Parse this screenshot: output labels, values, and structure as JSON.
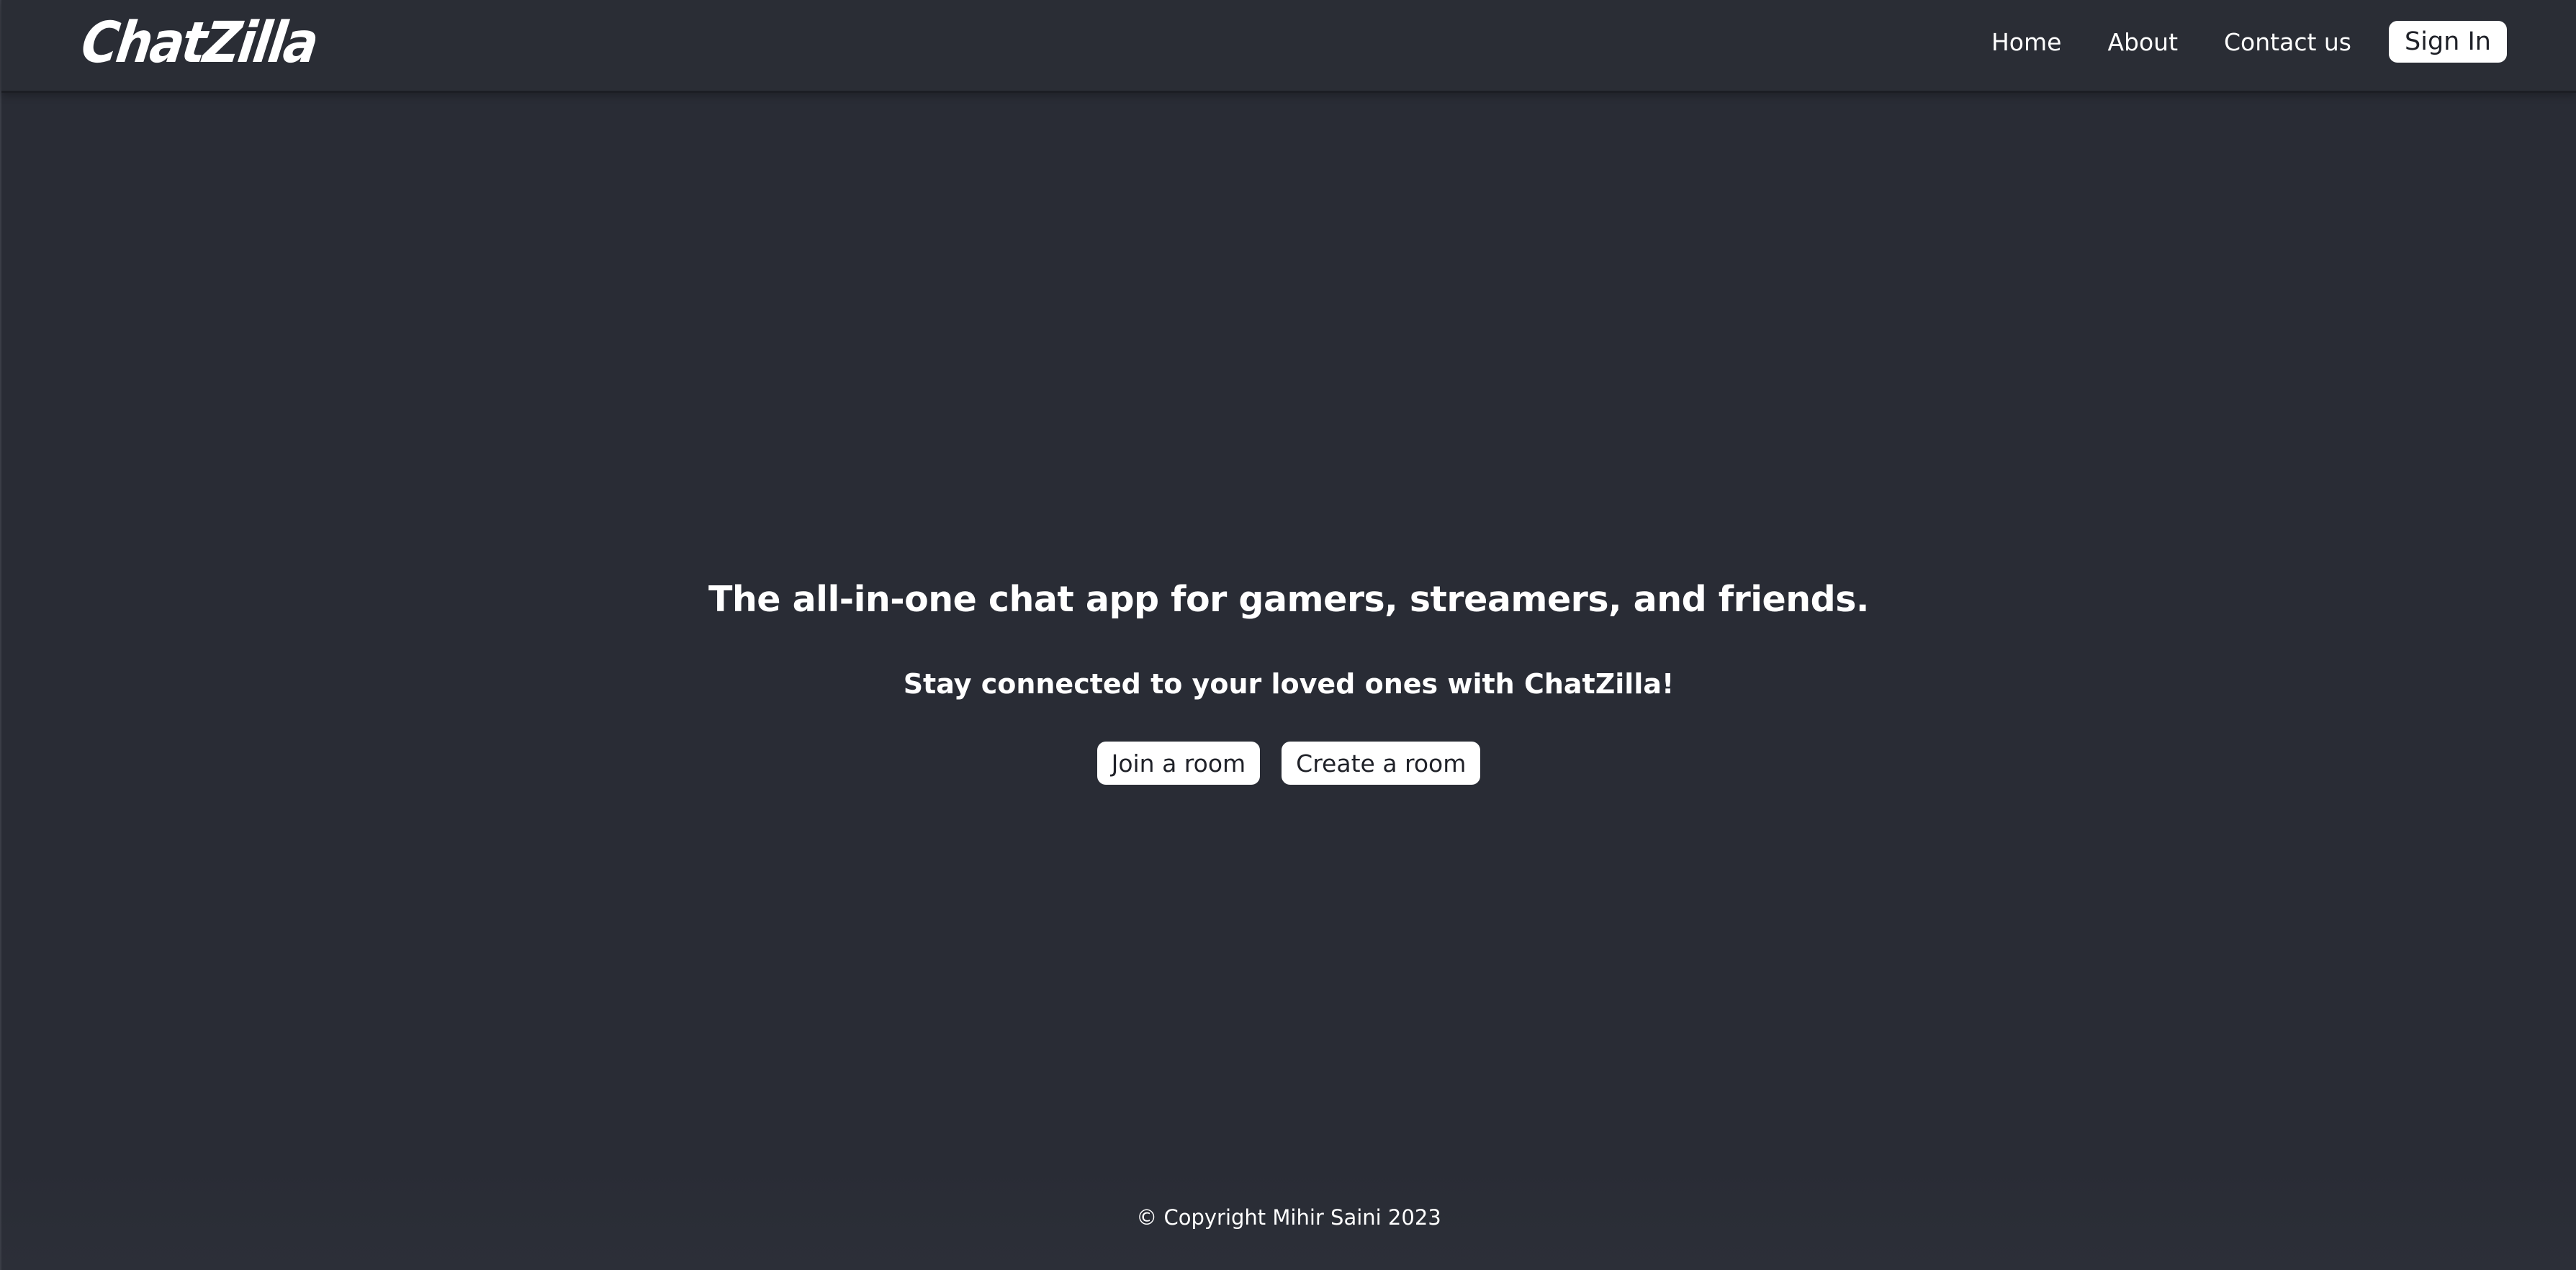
{
  "navbar": {
    "logo_text": "ChatZilla",
    "links": {
      "home": "Home",
      "about": "About",
      "contact": "Contact us"
    },
    "signin_label": "Sign In"
  },
  "hero": {
    "title": "The all-in-one chat app for gamers, streamers, and friends.",
    "subtitle": "Stay connected to your loved ones with ChatZilla!",
    "join_label": "Join a room",
    "create_label": "Create a room"
  },
  "footer": {
    "copyright": "© Copyright Mihir Saini 2023"
  },
  "colors": {
    "background": "#292c35",
    "button_bg": "#ffffff",
    "button_text": "#1f2128",
    "text": "#ffffff"
  }
}
